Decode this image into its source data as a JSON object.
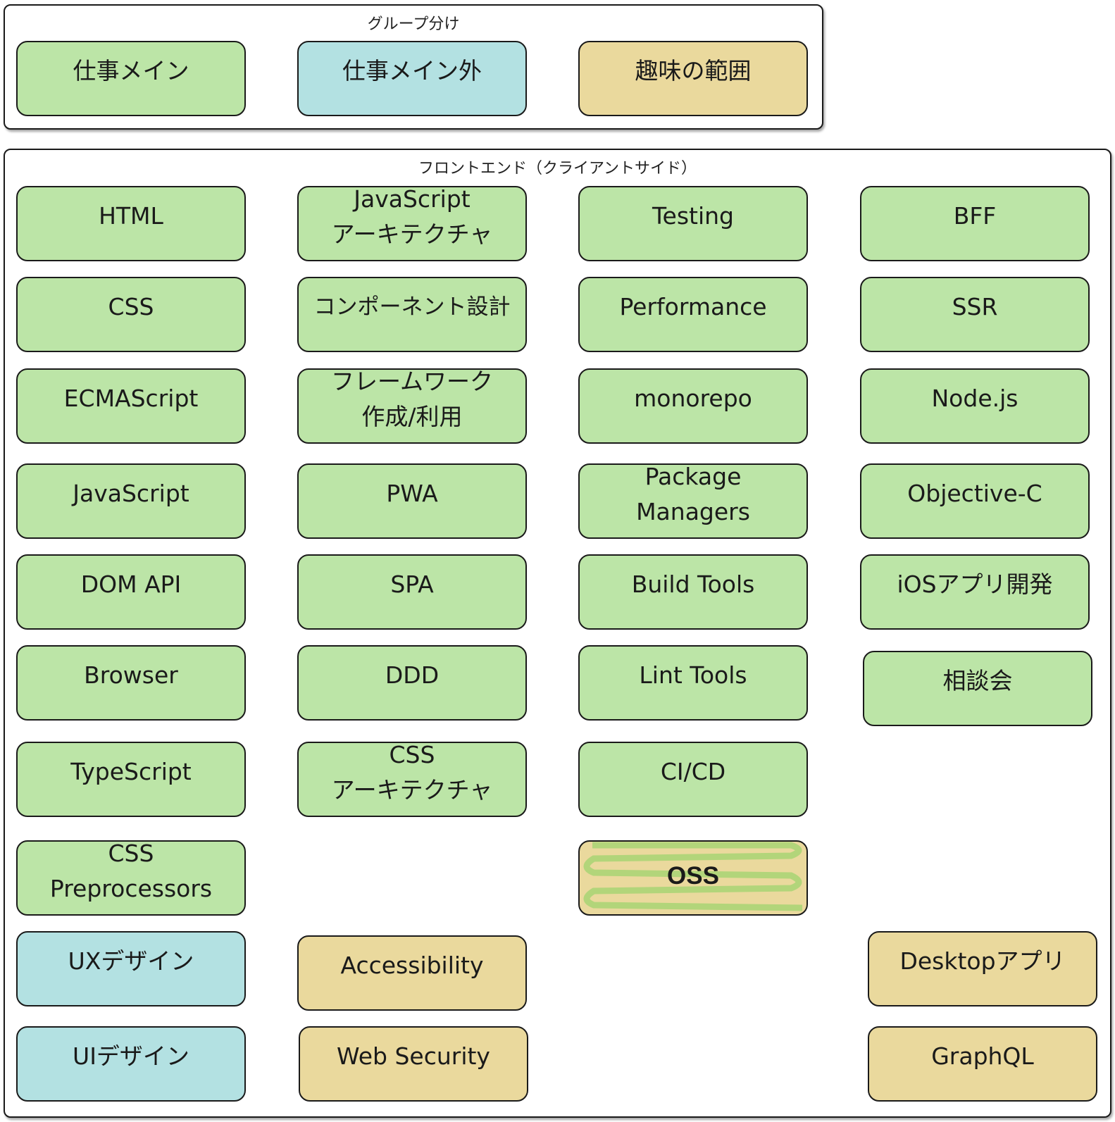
{
  "legend": {
    "title": "グループ分け",
    "items": [
      {
        "label": "仕事メイン",
        "category": "work-main",
        "color": "#bce5a7"
      },
      {
        "label": "仕事メイン外",
        "category": "work-other",
        "color": "#b3e1e2"
      },
      {
        "label": "趣味の範囲",
        "category": "hobby",
        "color": "#ead99d"
      }
    ]
  },
  "frontend": {
    "title": "フロントエンド（クライアントサイド）",
    "nodes": [
      {
        "label": "HTML",
        "category": "work-main"
      },
      {
        "label": "CSS",
        "category": "work-main"
      },
      {
        "label": "ECMAScript",
        "category": "work-main"
      },
      {
        "label": "JavaScript",
        "category": "work-main"
      },
      {
        "label": "DOM API",
        "category": "work-main"
      },
      {
        "label": "Browser",
        "category": "work-main"
      },
      {
        "label": "TypeScript",
        "category": "work-main"
      },
      {
        "label": "CSS\nPreprocessors",
        "category": "work-main"
      },
      {
        "label": "UXデザイン",
        "category": "work-other"
      },
      {
        "label": "UIデザイン",
        "category": "work-other"
      },
      {
        "label": "JavaScript\nアーキテクチャ",
        "category": "work-main"
      },
      {
        "label": "コンポーネント設計",
        "category": "work-main"
      },
      {
        "label": "フレームワーク\n作成/利用",
        "category": "work-main"
      },
      {
        "label": "PWA",
        "category": "work-main"
      },
      {
        "label": "SPA",
        "category": "work-main"
      },
      {
        "label": "DDD",
        "category": "work-main"
      },
      {
        "label": "CSS\nアーキテクチャ",
        "category": "work-main"
      },
      {
        "label": "Accessibility",
        "category": "hobby"
      },
      {
        "label": "Web Security",
        "category": "hobby"
      },
      {
        "label": "Testing",
        "category": "work-main"
      },
      {
        "label": "Performance",
        "category": "work-main"
      },
      {
        "label": "monorepo",
        "category": "work-main"
      },
      {
        "label": "Package\nManagers",
        "category": "work-main"
      },
      {
        "label": "Build Tools",
        "category": "work-main"
      },
      {
        "label": "Lint Tools",
        "category": "work-main"
      },
      {
        "label": "CI/CD",
        "category": "work-main"
      },
      {
        "label": "OSS",
        "category": "hobby+work-main"
      },
      {
        "label": "BFF",
        "category": "work-main"
      },
      {
        "label": "SSR",
        "category": "work-main"
      },
      {
        "label": "Node.js",
        "category": "work-main"
      },
      {
        "label": "Objective-C",
        "category": "work-main"
      },
      {
        "label": "iOSアプリ開発",
        "category": "work-main"
      },
      {
        "label": "相談会",
        "category": "work-main"
      },
      {
        "label": "Desktopアプリ",
        "category": "hobby"
      },
      {
        "label": "GraphQL",
        "category": "hobby"
      }
    ]
  }
}
